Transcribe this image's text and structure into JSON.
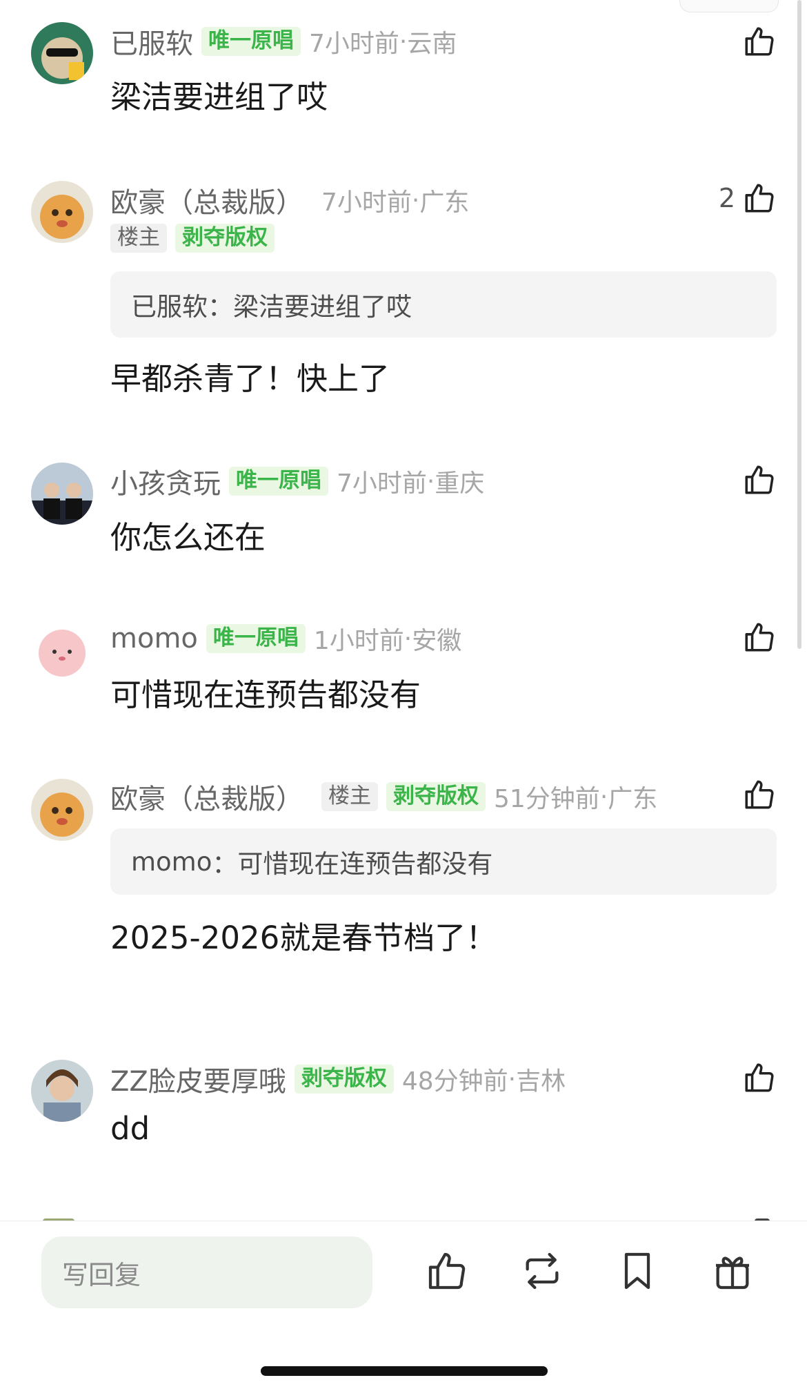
{
  "comments": [
    {
      "username": "已服软",
      "badges": [
        "唯一原唱"
      ],
      "time": "7小时前",
      "location": "云南",
      "likes": "",
      "text": "梁洁要进组了哎"
    },
    {
      "username": "欧豪（总裁版）",
      "badges": [
        "楼主",
        "剥夺版权"
      ],
      "time": "7小时前",
      "location": "广东",
      "likes": "2",
      "quote_author": "已服软",
      "quote_text": "梁洁要进组了哎",
      "text": "早都杀青了！快上了"
    },
    {
      "username": "小孩贪玩",
      "badges": [
        "唯一原唱"
      ],
      "time": "7小时前",
      "location": "重庆",
      "likes": "",
      "text": "你怎么还在"
    },
    {
      "username": "momo",
      "badges": [
        "唯一原唱"
      ],
      "time": "1小时前",
      "location": "安徽",
      "likes": "",
      "text": "可惜现在连预告都没有"
    },
    {
      "username": "欧豪（总裁版）",
      "badges": [
        "楼主",
        "剥夺版权"
      ],
      "time": "51分钟前",
      "location": "广东",
      "likes": "",
      "quote_author": "momo",
      "quote_text": "可惜现在连预告都没有",
      "text": "2025-2026就是春节档了！"
    },
    {
      "username": "ZZ脸皮要厚哦",
      "badges": [
        "剥夺版权"
      ],
      "time": "48分钟前",
      "location": "吉林",
      "likes": "",
      "text": "dd"
    }
  ],
  "separator": " · ",
  "quote_separator": "：",
  "bottom_bar": {
    "reply_placeholder": "写回复",
    "icons": [
      "like-icon",
      "repost-icon",
      "bookmark-icon",
      "gift-icon"
    ]
  },
  "colors": {
    "badge_green_text": "#3bb54a",
    "badge_green_bg": "#e9f7e3",
    "meta_gray": "#a6a6a6",
    "quote_bg": "#f4f4f4"
  }
}
